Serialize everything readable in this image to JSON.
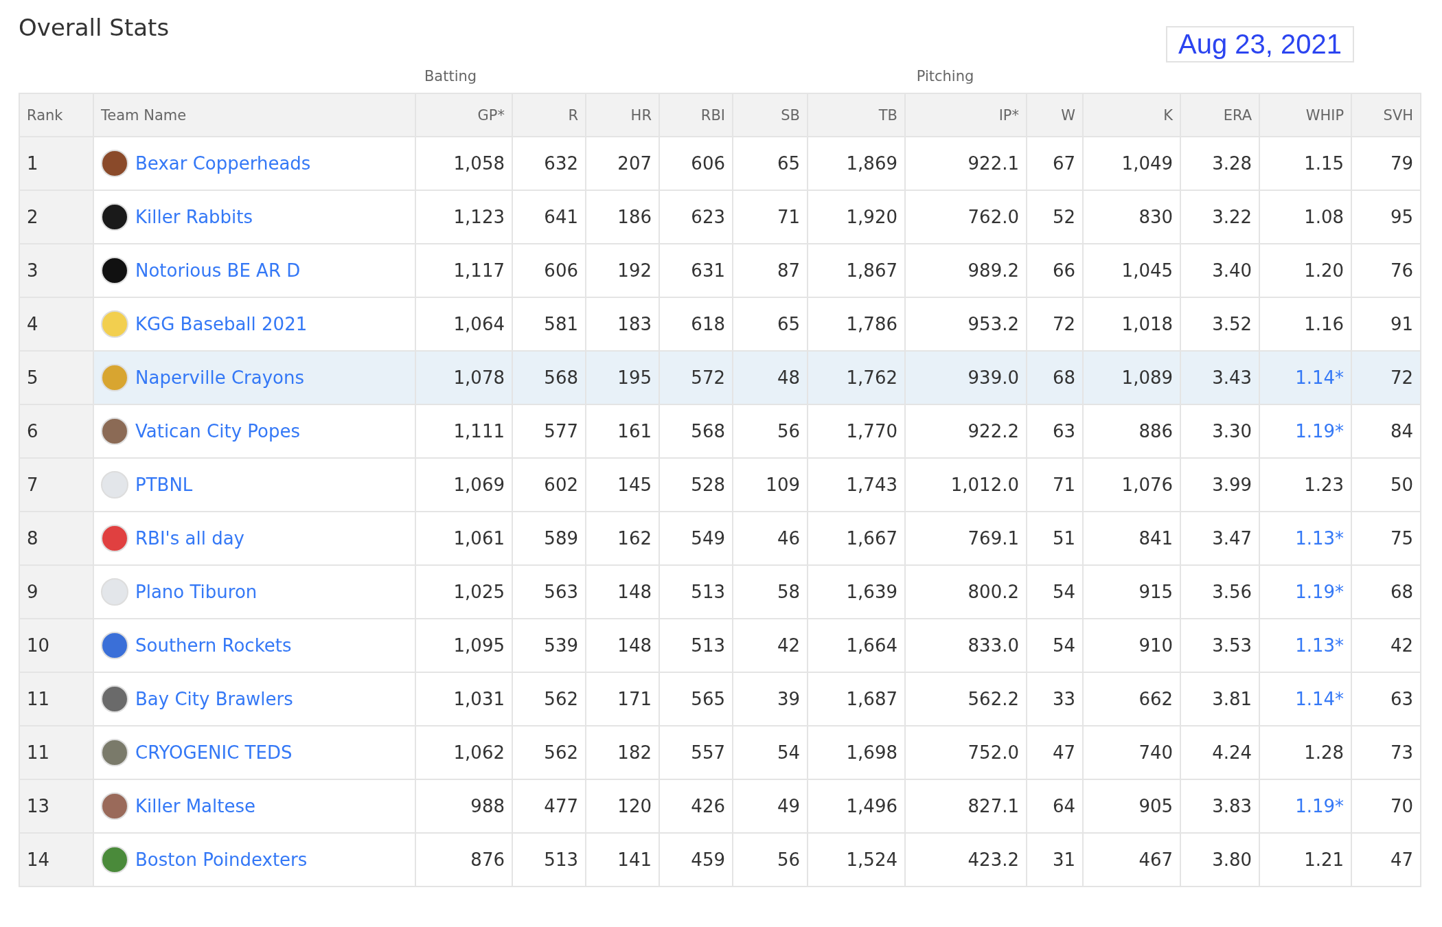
{
  "title": "Overall Stats",
  "date": "Aug 23, 2021",
  "groups": [
    "Batting",
    "Pitching"
  ],
  "columns": [
    "Rank",
    "Team Name",
    "GP*",
    "R",
    "HR",
    "RBI",
    "SB",
    "TB",
    "IP*",
    "W",
    "K",
    "ERA",
    "WHIP",
    "SVH"
  ],
  "rows": [
    {
      "rank": "1",
      "team": "Bexar Copperheads",
      "color": "#8a4a2a",
      "selected": false,
      "values": [
        "1,058",
        "632",
        "207",
        "606",
        "65",
        "1,869",
        "922.1",
        "67",
        "1,049",
        "3.28",
        "1.15",
        "79"
      ],
      "whip_linked": false
    },
    {
      "rank": "2",
      "team": "Killer Rabbits",
      "color": "#1a1a1a",
      "selected": false,
      "values": [
        "1,123",
        "641",
        "186",
        "623",
        "71",
        "1,920",
        "762.0",
        "52",
        "830",
        "3.22",
        "1.08",
        "95"
      ],
      "whip_linked": false
    },
    {
      "rank": "3",
      "team": "Notorious BE AR D",
      "color": "#111111",
      "selected": false,
      "values": [
        "1,117",
        "606",
        "192",
        "631",
        "87",
        "1,867",
        "989.2",
        "66",
        "1,045",
        "3.40",
        "1.20",
        "76"
      ],
      "whip_linked": false
    },
    {
      "rank": "4",
      "team": "KGG Baseball 2021",
      "color": "#f2cf4f",
      "selected": false,
      "values": [
        "1,064",
        "581",
        "183",
        "618",
        "65",
        "1,786",
        "953.2",
        "72",
        "1,018",
        "3.52",
        "1.16",
        "91"
      ],
      "whip_linked": false
    },
    {
      "rank": "5",
      "team": "Naperville Crayons",
      "color": "#d8a530",
      "selected": true,
      "values": [
        "1,078",
        "568",
        "195",
        "572",
        "48",
        "1,762",
        "939.0",
        "68",
        "1,089",
        "3.43",
        "1.14*",
        "72"
      ],
      "whip_linked": true
    },
    {
      "rank": "6",
      "team": "Vatican City Popes",
      "color": "#8b6a55",
      "selected": false,
      "values": [
        "1,111",
        "577",
        "161",
        "568",
        "56",
        "1,770",
        "922.2",
        "63",
        "886",
        "3.30",
        "1.19*",
        "84"
      ],
      "whip_linked": true
    },
    {
      "rank": "7",
      "team": "PTBNL",
      "color": "#e3e6ea",
      "selected": false,
      "values": [
        "1,069",
        "602",
        "145",
        "528",
        "109",
        "1,743",
        "1,012.0",
        "71",
        "1,076",
        "3.99",
        "1.23",
        "50"
      ],
      "whip_linked": false
    },
    {
      "rank": "8",
      "team": "RBI's all day",
      "color": "#e04040",
      "selected": false,
      "values": [
        "1,061",
        "589",
        "162",
        "549",
        "46",
        "1,667",
        "769.1",
        "51",
        "841",
        "3.47",
        "1.13*",
        "75"
      ],
      "whip_linked": true
    },
    {
      "rank": "9",
      "team": "Plano Tiburon",
      "color": "#e3e6ea",
      "selected": false,
      "values": [
        "1,025",
        "563",
        "148",
        "513",
        "58",
        "1,639",
        "800.2",
        "54",
        "915",
        "3.56",
        "1.19*",
        "68"
      ],
      "whip_linked": true
    },
    {
      "rank": "10",
      "team": "Southern Rockets",
      "color": "#3a6fd8",
      "selected": false,
      "values": [
        "1,095",
        "539",
        "148",
        "513",
        "42",
        "1,664",
        "833.0",
        "54",
        "910",
        "3.53",
        "1.13*",
        "42"
      ],
      "whip_linked": true
    },
    {
      "rank": "11",
      "team": "Bay City Brawlers",
      "color": "#6a6a6a",
      "selected": false,
      "values": [
        "1,031",
        "562",
        "171",
        "565",
        "39",
        "1,687",
        "562.2",
        "33",
        "662",
        "3.81",
        "1.14*",
        "63"
      ],
      "whip_linked": true
    },
    {
      "rank": "11",
      "team": "CRYOGENIC TEDS",
      "color": "#7a7a6a",
      "selected": false,
      "values": [
        "1,062",
        "562",
        "182",
        "557",
        "54",
        "1,698",
        "752.0",
        "47",
        "740",
        "4.24",
        "1.28",
        "73"
      ],
      "whip_linked": false
    },
    {
      "rank": "13",
      "team": "Killer Maltese",
      "color": "#9a6a5a",
      "selected": false,
      "values": [
        "988",
        "477",
        "120",
        "426",
        "49",
        "1,496",
        "827.1",
        "64",
        "905",
        "3.83",
        "1.19*",
        "70"
      ],
      "whip_linked": true
    },
    {
      "rank": "14",
      "team": "Boston Poindexters",
      "color": "#4a8a3a",
      "selected": false,
      "values": [
        "876",
        "513",
        "141",
        "459",
        "56",
        "1,524",
        "423.2",
        "31",
        "467",
        "3.80",
        "1.21",
        "47"
      ],
      "whip_linked": false
    }
  ]
}
